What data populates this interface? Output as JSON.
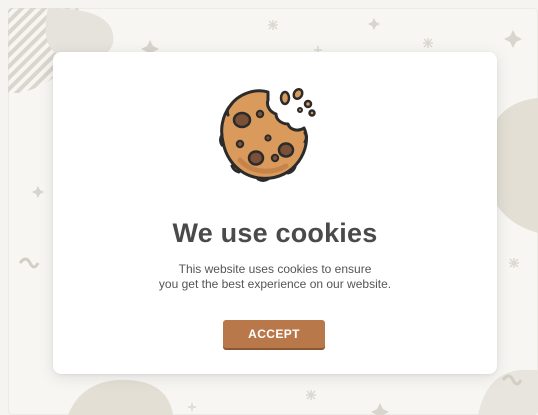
{
  "dialog": {
    "title": "We use cookies",
    "message_line1": "This website uses cookies to ensure",
    "message_line2": "you get the best experience on our website.",
    "accept_label": "ACCEPT"
  },
  "icons": {
    "illustration": "cookie-icon"
  },
  "colors": {
    "background": "#f5f4f1",
    "card": "#ffffff",
    "accent": "#b9784a",
    "cookie_fill": "#d99a5b",
    "cookie_chip": "#7a5036",
    "title_text": "#4a4a4a"
  }
}
